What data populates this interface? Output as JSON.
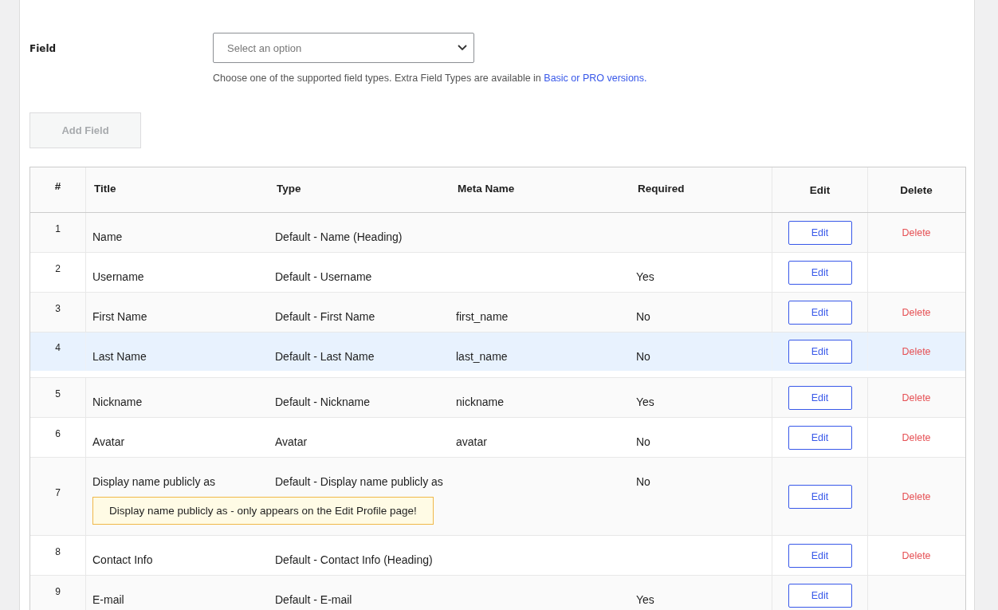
{
  "field": {
    "label": "Field",
    "placeholder": "Select an option",
    "help": "Choose one of the supported field types. Extra Field Types are available in",
    "help_link": "Basic or PRO versions."
  },
  "add_button": {
    "label": "Add Field",
    "disabled": true
  },
  "table": {
    "columns": [
      "#",
      "Title",
      "Type",
      "Meta Name",
      "Required",
      "Edit",
      "Delete"
    ],
    "rows": [
      {
        "num": "1",
        "title": "Name",
        "type": "Default - Name (Heading)",
        "edit": "Edit",
        "delete": "Delete",
        "dragging": false
      },
      {
        "num": "2",
        "title": "Username",
        "type": "Default - Username",
        "required": "Yes",
        "edit": "Edit",
        "dragging": false
      },
      {
        "num": "3",
        "title": "First Name",
        "type": "Default - First Name",
        "meta_name": "first_name",
        "required": "No",
        "edit": "Edit",
        "delete": "Delete",
        "dragging": false
      },
      {
        "num": "4",
        "title": "Last Name",
        "type": "Default - Last Name",
        "meta_name": "last_name",
        "required": "No",
        "edit": "Edit",
        "delete": "Delete",
        "dragging": true
      },
      {
        "num": "5",
        "title": "Nickname",
        "type": "Default - Nickname",
        "meta_name": "nickname",
        "required": "Yes",
        "edit": "Edit",
        "delete": "Delete",
        "dragging": false
      },
      {
        "num": "6",
        "title": "Avatar",
        "type": "Avatar",
        "meta_name": "avatar",
        "required": "No",
        "edit": "Edit",
        "delete": "Delete",
        "dragging": false
      },
      {
        "num": "7",
        "title": "Display name publicly as",
        "type": "Default - Display name publicly as",
        "required": "No",
        "note": "Display name publicly as - only appears on the Edit Profile page!",
        "edit": "Edit",
        "delete": "Delete",
        "dragging": false
      },
      {
        "num": "8",
        "title": "Contact Info",
        "type": "Default - Contact Info (Heading)",
        "edit": "Edit",
        "delete": "Delete",
        "dragging": false
      },
      {
        "num": "9",
        "title": "E-mail",
        "type": "Default - E-mail",
        "required": "Yes",
        "edit": "Edit",
        "dragging": false
      }
    ]
  }
}
